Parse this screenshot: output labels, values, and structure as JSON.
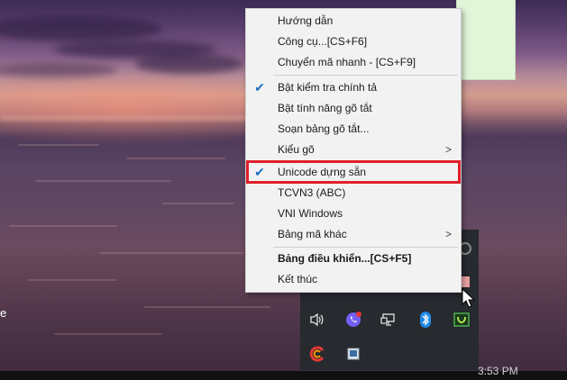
{
  "menu": {
    "items": [
      {
        "label": "Hướng dẫn",
        "checked": false,
        "submenu": false,
        "bold": false
      },
      {
        "label": "Công cụ...[CS+F6]",
        "checked": false,
        "submenu": false,
        "bold": false
      },
      {
        "label": "Chuyển mã nhanh - [CS+F9]",
        "checked": false,
        "submenu": false,
        "bold": false
      },
      {
        "label": "Bật kiểm tra chính tả",
        "checked": true,
        "submenu": false,
        "bold": false
      },
      {
        "label": "Bật tính năng gõ tắt",
        "checked": false,
        "submenu": false,
        "bold": false
      },
      {
        "label": "Soạn bảng gõ tắt...",
        "checked": false,
        "submenu": false,
        "bold": false
      },
      {
        "label": "Kiểu gõ",
        "checked": false,
        "submenu": true,
        "bold": false
      },
      {
        "label": "Unicode dựng sẵn",
        "checked": true,
        "submenu": false,
        "bold": false,
        "highlighted": true
      },
      {
        "label": "TCVN3 (ABC)",
        "checked": false,
        "submenu": false,
        "bold": false
      },
      {
        "label": "VNI Windows",
        "checked": false,
        "submenu": false,
        "bold": false
      },
      {
        "label": "Bảng mã khác",
        "checked": false,
        "submenu": true,
        "bold": false
      },
      {
        "label": "Bảng điều khiển...[CS+F5]",
        "checked": false,
        "submenu": false,
        "bold": true
      },
      {
        "label": "Kết thúc",
        "checked": false,
        "submenu": false,
        "bold": false
      }
    ],
    "check_glyph": "✔",
    "submenu_glyph": ">"
  },
  "taskbar": {
    "time": "3:53 PM"
  },
  "desktop": {
    "edge_text": "e"
  },
  "tray_icons": [
    "speaker-icon",
    "viber-icon",
    "network-icon",
    "bluetooth-icon",
    "unikey-icon",
    "ccleaner-icon",
    "monitor-icon"
  ],
  "colors": {
    "highlight_border": "#e01f2a",
    "check": "#1f6fbf",
    "menu_bg": "#f2f2f2",
    "viber": "#7360f2",
    "bluetooth": "#1e88e5",
    "unikey": "#4caf50"
  }
}
